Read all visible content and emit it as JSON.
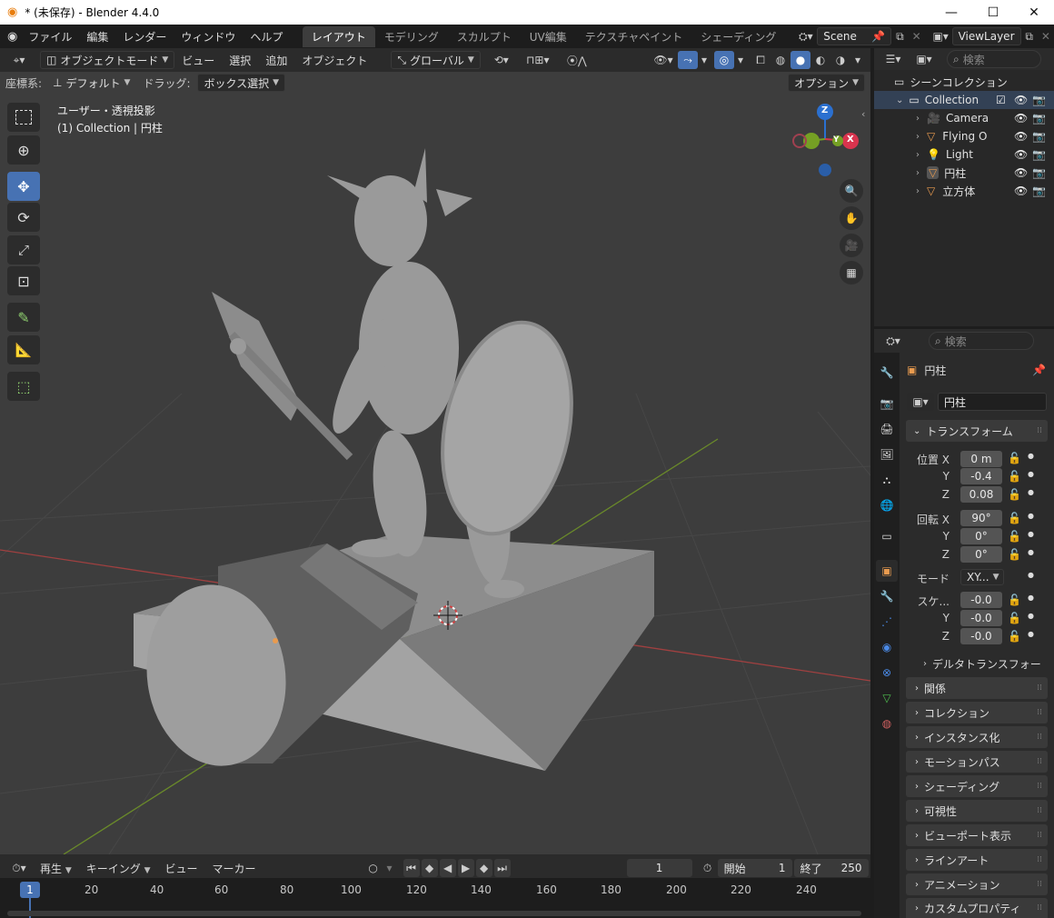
{
  "window": {
    "title": "* (未保存) - Blender 4.4.0",
    "min": "—",
    "max": "☐",
    "close": "✕"
  },
  "menu": [
    "ファイル",
    "編集",
    "レンダー",
    "ウィンドウ",
    "ヘルプ"
  ],
  "workspaces": [
    "レイアウト",
    "モデリング",
    "スカルプト",
    "UV編集",
    "テクスチャペイント",
    "シェーディング"
  ],
  "scene": "Scene",
  "viewlayer": "ViewLayer",
  "viewport_header": {
    "mode": "オブジェクトモード",
    "menus": [
      "ビュー",
      "選択",
      "追加",
      "オブジェクト"
    ],
    "transform_orientation": "グローバル"
  },
  "tool_settings": {
    "coord_label": "座標系:",
    "coord_value": "デフォルト",
    "drag_label": "ドラッグ:",
    "drag_value": "ボックス選択",
    "options": "オプション"
  },
  "viewport": {
    "view_name": "ユーザー・透視投影",
    "context": "(1) Collection | 円柱",
    "gizmo": {
      "z": "Z",
      "y": "Y",
      "x": "X"
    }
  },
  "outliner": {
    "search_placeholder": "検索",
    "root": "シーンコレクション",
    "collection": "Collection",
    "items": [
      {
        "name": "Camera",
        "icon": "camera-icon",
        "color": "#e99b4f"
      },
      {
        "name": "Flying O",
        "icon": "mesh-icon",
        "color": "#e99b4f"
      },
      {
        "name": "Light",
        "icon": "light-icon",
        "color": "#e99b4f"
      },
      {
        "name": "円柱",
        "icon": "mesh-icon",
        "color": "#e99b4f"
      },
      {
        "name": "立方体",
        "icon": "mesh-icon",
        "color": "#e99b4f"
      }
    ]
  },
  "properties": {
    "search_placeholder": "検索",
    "object_name": "円柱",
    "object_field": "円柱",
    "transform_title": "トランスフォーム",
    "location_label": "位置 X",
    "location": [
      "0 m",
      "-0.4",
      "0.08"
    ],
    "rotation_label": "回転 X",
    "rotation": [
      "90°",
      "0°",
      "0°"
    ],
    "mode_label": "モード",
    "mode_value": "XY...",
    "scale_label": "スケ...",
    "scale": [
      "-0.0",
      "-0.0",
      "-0.0"
    ],
    "axis_y": "Y",
    "axis_z": "Z",
    "delta": "デルタトランスフォー",
    "panels": [
      "関係",
      "コレクション",
      "インスタンス化",
      "モーションパス",
      "シェーディング",
      "可視性",
      "ビューポート表示",
      "ラインアート",
      "アニメーション",
      "カスタムプロパティ"
    ]
  },
  "timeline": {
    "play": "再生",
    "keying": "キーイング",
    "view": "ビュー",
    "marker": "マーカー",
    "current_frame": "1",
    "start_label": "開始",
    "start": "1",
    "end_label": "終了",
    "end": "250",
    "ruler": [
      "1",
      "20",
      "40",
      "60",
      "80",
      "100",
      "120",
      "140",
      "160",
      "180",
      "200",
      "220",
      "240"
    ]
  },
  "colors": {
    "accent": "#4772b3",
    "grid_red": "#a04040",
    "grid_green": "#6a8a2a",
    "object_orange": "#e99b4f"
  }
}
